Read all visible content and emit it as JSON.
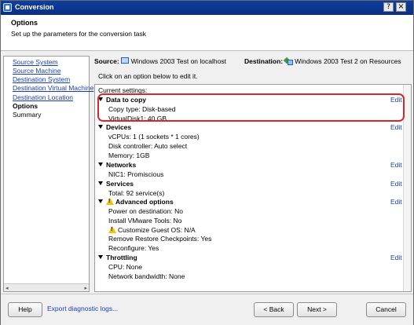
{
  "window": {
    "title": "Conversion"
  },
  "header": {
    "title": "Options",
    "subtitle": "Set up the parameters for the conversion task"
  },
  "nav": {
    "items": [
      {
        "label": "Source System",
        "state": "link"
      },
      {
        "label": "Source Machine",
        "state": "link"
      },
      {
        "label": "Destination System",
        "state": "link"
      },
      {
        "label": "Destination Virtual Machine",
        "state": "link"
      },
      {
        "label": "Destination Location",
        "state": "link"
      },
      {
        "label": "Options",
        "state": "active"
      },
      {
        "label": "Summary",
        "state": "plain"
      }
    ]
  },
  "source": {
    "label": "Source:",
    "value": "Windows 2003 Test on localhost"
  },
  "destination": {
    "label": "Destination:",
    "value": "Windows 2003 Test 2 on Resources"
  },
  "hint": "Click on an option below to edit it.",
  "current_settings_label": "Current settings:",
  "edit_label": "Edit",
  "sections": {
    "data_to_copy": {
      "title": "Data to copy",
      "lines": [
        "Copy type: Disk-based",
        "VirtualDisk1: 40 GB"
      ]
    },
    "devices": {
      "title": "Devices",
      "lines": [
        "vCPUs: 1 (1 sockets * 1 cores)",
        "Disk controller: Auto select",
        "Memory: 1GB"
      ]
    },
    "networks": {
      "title": "Networks",
      "lines": [
        "NIC1: Promiscious"
      ]
    },
    "services": {
      "title": "Services",
      "lines": [
        "Total: 92 service(s)"
      ]
    },
    "advanced": {
      "title": "Advanced options",
      "lines": [
        "Power on destination: No",
        "Install VMware Tools: No",
        "Customize Guest OS: N/A",
        "Remove Restore Checkpoints: Yes",
        "Reconfigure: Yes"
      ]
    },
    "throttling": {
      "title": "Throttling",
      "lines": [
        "CPU: None",
        "Network bandwidth: None"
      ]
    }
  },
  "footer": {
    "help": "Help",
    "export": "Export diagnostic logs...",
    "back": "< Back",
    "next": "Next >",
    "cancel": "Cancel"
  },
  "colors": {
    "titlebar": "#0d3ea0",
    "link": "#1a3fb0",
    "highlight": "#d6262f"
  }
}
